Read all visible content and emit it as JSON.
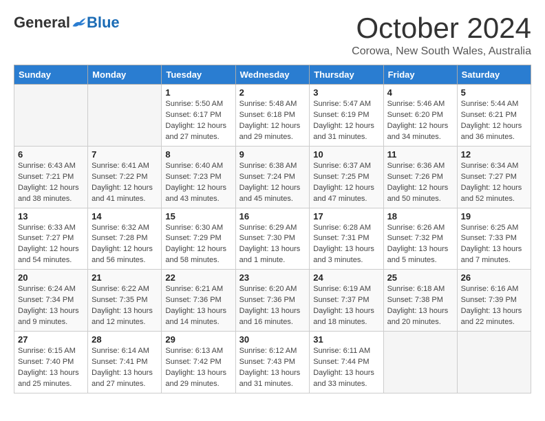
{
  "header": {
    "logo_general": "General",
    "logo_blue": "Blue",
    "month": "October 2024",
    "location": "Corowa, New South Wales, Australia"
  },
  "days_of_week": [
    "Sunday",
    "Monday",
    "Tuesday",
    "Wednesday",
    "Thursday",
    "Friday",
    "Saturday"
  ],
  "weeks": [
    [
      {
        "day": "",
        "info": ""
      },
      {
        "day": "",
        "info": ""
      },
      {
        "day": "1",
        "info": "Sunrise: 5:50 AM\nSunset: 6:17 PM\nDaylight: 12 hours\nand 27 minutes."
      },
      {
        "day": "2",
        "info": "Sunrise: 5:48 AM\nSunset: 6:18 PM\nDaylight: 12 hours\nand 29 minutes."
      },
      {
        "day": "3",
        "info": "Sunrise: 5:47 AM\nSunset: 6:19 PM\nDaylight: 12 hours\nand 31 minutes."
      },
      {
        "day": "4",
        "info": "Sunrise: 5:46 AM\nSunset: 6:20 PM\nDaylight: 12 hours\nand 34 minutes."
      },
      {
        "day": "5",
        "info": "Sunrise: 5:44 AM\nSunset: 6:21 PM\nDaylight: 12 hours\nand 36 minutes."
      }
    ],
    [
      {
        "day": "6",
        "info": "Sunrise: 6:43 AM\nSunset: 7:21 PM\nDaylight: 12 hours\nand 38 minutes."
      },
      {
        "day": "7",
        "info": "Sunrise: 6:41 AM\nSunset: 7:22 PM\nDaylight: 12 hours\nand 41 minutes."
      },
      {
        "day": "8",
        "info": "Sunrise: 6:40 AM\nSunset: 7:23 PM\nDaylight: 12 hours\nand 43 minutes."
      },
      {
        "day": "9",
        "info": "Sunrise: 6:38 AM\nSunset: 7:24 PM\nDaylight: 12 hours\nand 45 minutes."
      },
      {
        "day": "10",
        "info": "Sunrise: 6:37 AM\nSunset: 7:25 PM\nDaylight: 12 hours\nand 47 minutes."
      },
      {
        "day": "11",
        "info": "Sunrise: 6:36 AM\nSunset: 7:26 PM\nDaylight: 12 hours\nand 50 minutes."
      },
      {
        "day": "12",
        "info": "Sunrise: 6:34 AM\nSunset: 7:27 PM\nDaylight: 12 hours\nand 52 minutes."
      }
    ],
    [
      {
        "day": "13",
        "info": "Sunrise: 6:33 AM\nSunset: 7:27 PM\nDaylight: 12 hours\nand 54 minutes."
      },
      {
        "day": "14",
        "info": "Sunrise: 6:32 AM\nSunset: 7:28 PM\nDaylight: 12 hours\nand 56 minutes."
      },
      {
        "day": "15",
        "info": "Sunrise: 6:30 AM\nSunset: 7:29 PM\nDaylight: 12 hours\nand 58 minutes."
      },
      {
        "day": "16",
        "info": "Sunrise: 6:29 AM\nSunset: 7:30 PM\nDaylight: 13 hours\nand 1 minute."
      },
      {
        "day": "17",
        "info": "Sunrise: 6:28 AM\nSunset: 7:31 PM\nDaylight: 13 hours\nand 3 minutes."
      },
      {
        "day": "18",
        "info": "Sunrise: 6:26 AM\nSunset: 7:32 PM\nDaylight: 13 hours\nand 5 minutes."
      },
      {
        "day": "19",
        "info": "Sunrise: 6:25 AM\nSunset: 7:33 PM\nDaylight: 13 hours\nand 7 minutes."
      }
    ],
    [
      {
        "day": "20",
        "info": "Sunrise: 6:24 AM\nSunset: 7:34 PM\nDaylight: 13 hours\nand 9 minutes."
      },
      {
        "day": "21",
        "info": "Sunrise: 6:22 AM\nSunset: 7:35 PM\nDaylight: 13 hours\nand 12 minutes."
      },
      {
        "day": "22",
        "info": "Sunrise: 6:21 AM\nSunset: 7:36 PM\nDaylight: 13 hours\nand 14 minutes."
      },
      {
        "day": "23",
        "info": "Sunrise: 6:20 AM\nSunset: 7:36 PM\nDaylight: 13 hours\nand 16 minutes."
      },
      {
        "day": "24",
        "info": "Sunrise: 6:19 AM\nSunset: 7:37 PM\nDaylight: 13 hours\nand 18 minutes."
      },
      {
        "day": "25",
        "info": "Sunrise: 6:18 AM\nSunset: 7:38 PM\nDaylight: 13 hours\nand 20 minutes."
      },
      {
        "day": "26",
        "info": "Sunrise: 6:16 AM\nSunset: 7:39 PM\nDaylight: 13 hours\nand 22 minutes."
      }
    ],
    [
      {
        "day": "27",
        "info": "Sunrise: 6:15 AM\nSunset: 7:40 PM\nDaylight: 13 hours\nand 25 minutes."
      },
      {
        "day": "28",
        "info": "Sunrise: 6:14 AM\nSunset: 7:41 PM\nDaylight: 13 hours\nand 27 minutes."
      },
      {
        "day": "29",
        "info": "Sunrise: 6:13 AM\nSunset: 7:42 PM\nDaylight: 13 hours\nand 29 minutes."
      },
      {
        "day": "30",
        "info": "Sunrise: 6:12 AM\nSunset: 7:43 PM\nDaylight: 13 hours\nand 31 minutes."
      },
      {
        "day": "31",
        "info": "Sunrise: 6:11 AM\nSunset: 7:44 PM\nDaylight: 13 hours\nand 33 minutes."
      },
      {
        "day": "",
        "info": ""
      },
      {
        "day": "",
        "info": ""
      }
    ]
  ]
}
